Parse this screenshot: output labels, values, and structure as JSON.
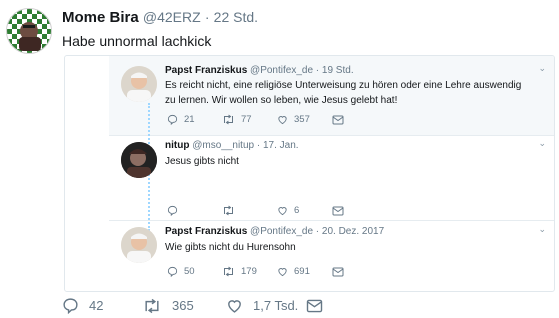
{
  "tweet": {
    "name": "Mome Bira",
    "handle": "@42ERZ",
    "time": "22 Std.",
    "text": "Habe unnormal lachkick",
    "reply_count": "42",
    "retweet_count": "365",
    "like_count": "1,7 Tsd."
  },
  "embed": {
    "tweets": [
      {
        "name": "Papst Franziskus",
        "handle": "@Pontifex_de",
        "time": "19 Std.",
        "text_line1": "Es reicht nicht, eine religiöse Unterweisung zu hören oder eine Lehre auswendig",
        "text_line2": "zu lernen. Wir wollen so leben, wie Jesus gelebt hat!",
        "replies": "21",
        "retweets": "77",
        "likes": "357"
      },
      {
        "name": "nitup",
        "handle": "@mso__nitup",
        "time": "17. Jan.",
        "text": "Jesus gibts nicht",
        "likes": "6"
      },
      {
        "name": "Papst Franziskus",
        "handle": "@Pontifex_de",
        "time": "20. Dez. 2017",
        "text": "Wie gibts nicht du Hurensohn",
        "replies": "50",
        "retweets": "179",
        "likes": "691"
      }
    ]
  },
  "colors": {
    "text": "#14171a",
    "muted": "#657786",
    "thread": "#9fd7ff",
    "border": "#e1e8ed"
  },
  "icons": [
    "reply-icon",
    "retweet-icon",
    "like-icon",
    "message-icon",
    "chevron-down-icon"
  ]
}
